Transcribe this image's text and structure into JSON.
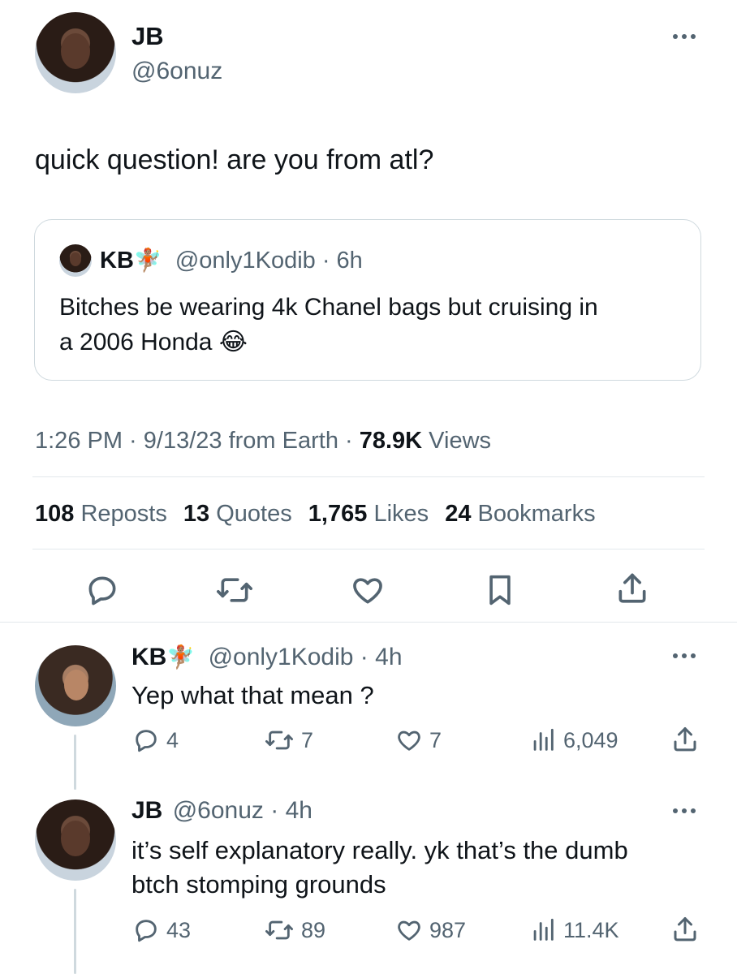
{
  "tweet": {
    "author_name": "JB",
    "author_handle": "@6onuz",
    "text": "quick question! are you from atl?",
    "timestamp": "1:26 PM · 9/13/23 from Earth · ",
    "views_count": "78.9K",
    "views_label": " Views",
    "quoted": {
      "author_name": "KB",
      "author_emoji": "🧚🏽",
      "author_handle": "@only1Kodib",
      "time": " · 6h",
      "text_line1": "Bitches be wearing 4k Chanel bags but cruising in",
      "text_line2": "a 2006 Honda",
      "emoji": "😂"
    },
    "stats": {
      "reposts_count": "108",
      "reposts_label": "Reposts",
      "quotes_count": "13",
      "quotes_label": "Quotes",
      "likes_count": "1,765",
      "likes_label": "Likes",
      "bookmarks_count": "24",
      "bookmarks_label": "Bookmarks"
    }
  },
  "replies": [
    {
      "author_name": "KB",
      "author_emoji": "🧚🏽",
      "author_handle": "@only1Kodib",
      "time": " · 4h",
      "text_line1": "Yep what that mean ?",
      "text_line2": "",
      "replies": "4",
      "reposts": "7",
      "likes": "7",
      "views": "6,049"
    },
    {
      "author_name": "JB",
      "author_handle": "@6onuz",
      "time": " · 4h",
      "text_line1": "it’s self explanatory really. yk that’s the dumb",
      "text_line2": "btch stomping grounds",
      "replies": "43",
      "reposts": "89",
      "likes": "987",
      "views": "11.4K"
    }
  ],
  "icons": {
    "reply": "speech-bubble-icon",
    "repost": "repost-arrows-icon",
    "like": "heart-icon",
    "bookmark": "bookmark-icon",
    "share": "share-upload-icon",
    "views": "bar-chart-icon",
    "more": "more-dots-icon"
  },
  "colors": {
    "text": "#0f1419",
    "muted": "#536471",
    "divider": "#e3e8ec"
  }
}
